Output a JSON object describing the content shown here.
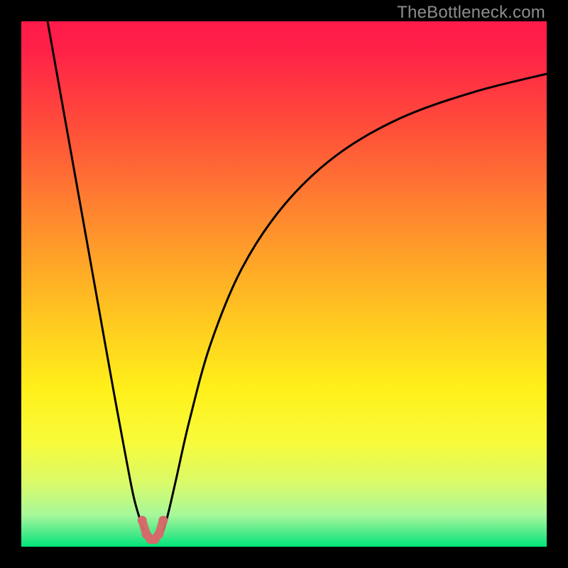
{
  "watermark": "TheBottleneck.com",
  "colors": {
    "bg": "#000000",
    "watermark": "#8d8d8d",
    "curve": "#000000",
    "marker_stroke": "#d46a6a",
    "marker_fill": "#d46a6a"
  },
  "chart_data": {
    "type": "line",
    "title": "",
    "xlabel": "",
    "ylabel": "",
    "xlim": [
      0,
      100
    ],
    "ylim": [
      0,
      100
    ],
    "grid": false,
    "gradient_stops": [
      {
        "offset": 0.0,
        "color": "#ff1a4a"
      },
      {
        "offset": 0.05,
        "color": "#ff2048"
      },
      {
        "offset": 0.2,
        "color": "#ff4d3a"
      },
      {
        "offset": 0.38,
        "color": "#ff8b2e"
      },
      {
        "offset": 0.55,
        "color": "#ffc321"
      },
      {
        "offset": 0.7,
        "color": "#fff01a"
      },
      {
        "offset": 0.8,
        "color": "#f8fb3a"
      },
      {
        "offset": 0.88,
        "color": "#d9fa6a"
      },
      {
        "offset": 0.94,
        "color": "#a6f89a"
      },
      {
        "offset": 0.975,
        "color": "#4be989"
      },
      {
        "offset": 1.0,
        "color": "#00e57a"
      }
    ],
    "series": [
      {
        "name": "bottleneck-curve",
        "x": [
          5.0,
          7.5,
          10.0,
          12.5,
          15.0,
          17.5,
          20.0,
          21.5,
          23.0,
          24.0,
          25.0,
          26.0,
          27.0,
          28.0,
          29.5,
          32.0,
          36.0,
          42.0,
          50.0,
          60.0,
          72.0,
          86.0,
          100.0
        ],
        "y": [
          100.0,
          86.0,
          72.0,
          58.0,
          44.0,
          30.0,
          16.5,
          9.0,
          4.0,
          1.8,
          1.2,
          1.5,
          3.0,
          6.5,
          13.0,
          24.0,
          38.5,
          53.0,
          65.0,
          74.5,
          81.5,
          86.5,
          90.0
        ]
      }
    ],
    "markers": {
      "name": "bottom-marker-cluster",
      "x": [
        23.0,
        23.8,
        24.6,
        25.4,
        26.2,
        27.0
      ],
      "y": [
        5.0,
        2.4,
        1.4,
        1.4,
        2.4,
        5.0
      ]
    }
  }
}
